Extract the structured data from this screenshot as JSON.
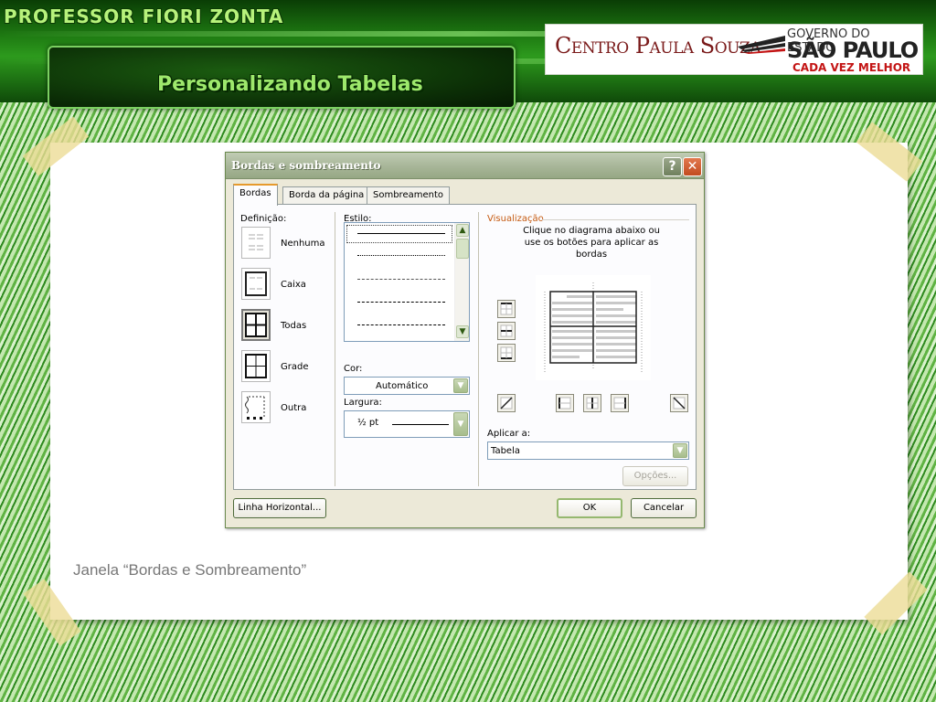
{
  "header": {
    "brand": "PROFESSOR FIORI ZONTA",
    "slide_title": "Personalizando Tabelas",
    "logo_cps": "Centro Paula Souza",
    "logo_gov": "GOVERNO DO ESTADO",
    "logo_sp": "SÃO PAULO",
    "logo_slogan": "CADA VEZ MELHOR"
  },
  "caption": "Janela “Bordas e Sombreamento”",
  "dialog": {
    "title": "Bordas e sombreamento",
    "help_glyph": "?",
    "close_glyph": "✕",
    "tabs": [
      {
        "label": "Bordas",
        "active": true
      },
      {
        "label": "Borda da página",
        "active": false
      },
      {
        "label": "Sombreamento",
        "active": false
      }
    ],
    "definicao_label": "Definição:",
    "settings": [
      {
        "label": "Nenhuma"
      },
      {
        "label": "Caixa"
      },
      {
        "label": "Todas",
        "selected": true
      },
      {
        "label": "Grade"
      },
      {
        "label": "Outra"
      }
    ],
    "estilo_label": "Estilo:",
    "cor_label": "Cor:",
    "cor_value": "Automático",
    "largura_label": "Largura:",
    "largura_value": "½ pt",
    "visualizacao_label": "Visualização",
    "preview_hint": "Clique no diagrama abaixo ou use os botões para aplicar as bordas",
    "aplicar_label": "Aplicar a:",
    "aplicar_value": "Tabela",
    "opcoes_button": "Opções...",
    "linha_horizontal_button": "Linha Horizontal...",
    "ok_button": "OK",
    "cancelar_button": "Cancelar"
  },
  "colors": {
    "header_green": "#1e7a12",
    "slide_title_green": "#9ee86c",
    "cps_red": "#7a1a1a",
    "slogan_red": "#c31414",
    "dialog_bg": "#ece9d8",
    "tab_accent": "#e69a2d"
  }
}
